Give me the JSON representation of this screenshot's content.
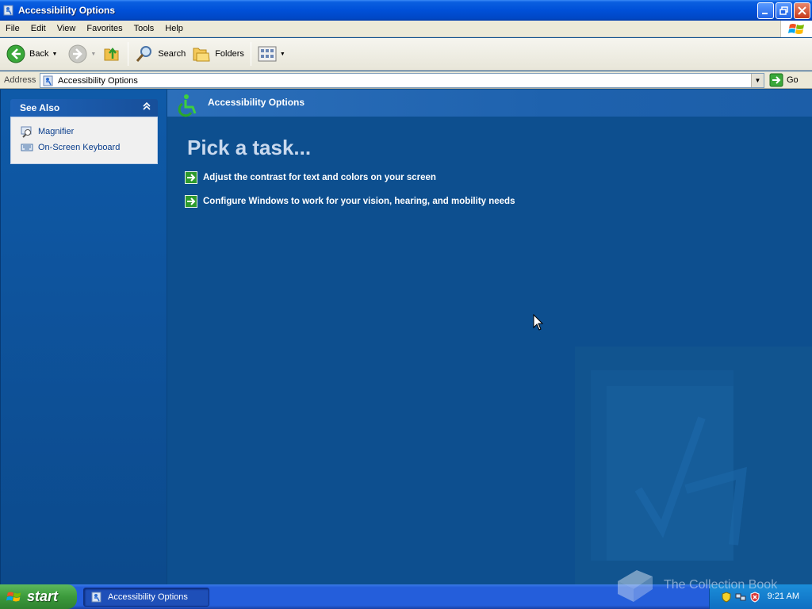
{
  "window": {
    "title": "Accessibility Options"
  },
  "menu": [
    "File",
    "Edit",
    "View",
    "Favorites",
    "Tools",
    "Help"
  ],
  "toolbar": {
    "back": "Back",
    "search": "Search",
    "folders": "Folders"
  },
  "address": {
    "label": "Address",
    "value": "Accessibility Options",
    "go": "Go"
  },
  "see_also": {
    "title": "See Also",
    "items": [
      "Magnifier",
      "On-Screen Keyboard"
    ]
  },
  "main": {
    "header": "Accessibility Options",
    "pick_title": "Pick a task...",
    "tasks": [
      "Adjust the contrast for text and colors on your screen",
      "Configure Windows to work for your vision, hearing, and mobility needs"
    ]
  },
  "taskbar": {
    "start": "start",
    "item": "Accessibility Options",
    "clock": "9:21 AM"
  },
  "brand": "The Collection Book",
  "colors": {
    "title_bar": "#0050d8",
    "pane_blue": "#0d4f8f",
    "start_green": "#3c9a3c"
  }
}
